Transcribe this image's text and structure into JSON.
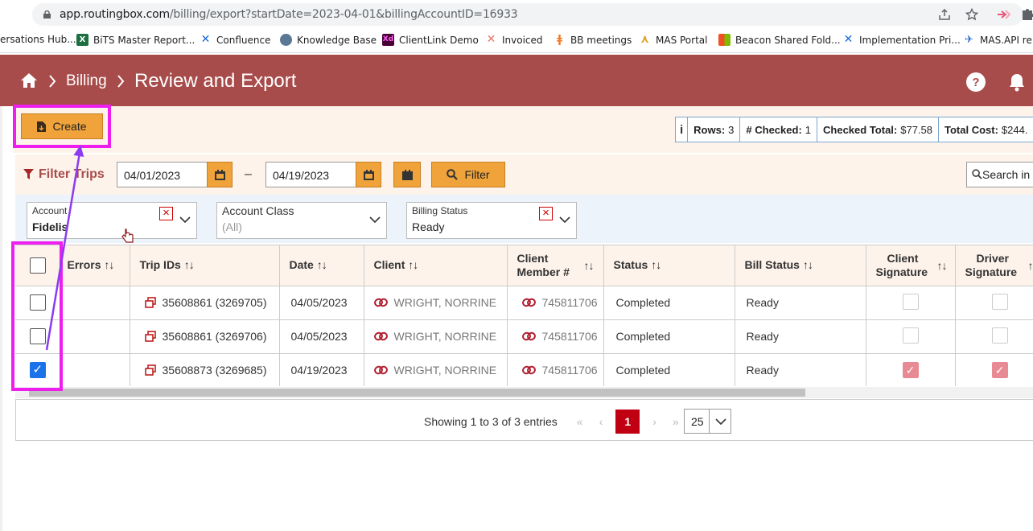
{
  "browser": {
    "url_host": "app.routingbox.com",
    "url_path": "/billing/export?startDate=2023-04-01&billingAccountID=16933",
    "bookmarks": [
      {
        "label": "ersations Hub...",
        "icon": "none"
      },
      {
        "label": "BiTS Master Report...",
        "icon": "excel-icon"
      },
      {
        "label": "Confluence",
        "icon": "confluence-icon"
      },
      {
        "label": "Knowledge Base",
        "icon": "globe-icon"
      },
      {
        "label": "ClientLink Demo",
        "icon": "xd-icon"
      },
      {
        "label": "Invoiced",
        "icon": "invoiced-icon"
      },
      {
        "label": "BB meetings",
        "icon": "hubspot-icon"
      },
      {
        "label": "MAS Portal",
        "icon": "mas-icon"
      },
      {
        "label": "Beacon Shared Fold...",
        "icon": "windows-icon"
      },
      {
        "label": "Implementation Pri...",
        "icon": "confluence-icon"
      },
      {
        "label": "MAS.API re",
        "icon": "api-icon"
      }
    ]
  },
  "header": {
    "crumb1": "Billing",
    "crumb2": "Review and Export",
    "help_icon": "help-icon",
    "bell_icon": "bell-icon"
  },
  "toolbar": {
    "create_label": "Create",
    "summary": {
      "info": "i",
      "rows_label": "Rows:",
      "rows_value": "3",
      "checked_label": "# Checked:",
      "checked_value": "1",
      "checked_total_label": "Checked Total:",
      "checked_total_value": "$77.58",
      "total_cost_label": "Total Cost:",
      "total_cost_value": "$244."
    }
  },
  "filters": {
    "title": "Filter Trips",
    "start_date": "04/01/2023",
    "separator": "–",
    "end_date": "04/19/2023",
    "filter_label": "Filter",
    "search_placeholder": "Search in",
    "account_label": "Account",
    "account_value": "Fidelis",
    "account_class_label": "Account Class",
    "account_class_value": "(All)",
    "billing_status_label": "Billing Status",
    "billing_status_value": "Ready"
  },
  "table": {
    "headers": {
      "errors": "Errors",
      "trip_ids": "Trip IDs",
      "date": "Date",
      "client": "Client",
      "member_line1": "Client",
      "member_line2": "Member #",
      "status": "Status",
      "bill_status": "Bill Status",
      "client_sig_line1": "Client",
      "client_sig_line2": "Signature",
      "driver_sig_line1": "Driver",
      "driver_sig_line2": "Signature",
      "sort_glyph": "↑↓"
    },
    "rows": [
      {
        "checked": false,
        "trip": "35608861 (3269705)",
        "date": "04/05/2023",
        "client": "WRIGHT, NORRINE",
        "member": "745811706",
        "status": "Completed",
        "bill_status": "Ready",
        "client_sig": false,
        "driver_sig": false
      },
      {
        "checked": false,
        "trip": "35608861 (3269706)",
        "date": "04/05/2023",
        "client": "WRIGHT, NORRINE",
        "member": "745811706",
        "status": "Completed",
        "bill_status": "Ready",
        "client_sig": false,
        "driver_sig": false
      },
      {
        "checked": true,
        "trip": "35608873 (3269685)",
        "date": "04/19/2023",
        "client": "WRIGHT, NORRINE",
        "member": "745811706",
        "status": "Completed",
        "bill_status": "Ready",
        "client_sig": true,
        "driver_sig": true
      }
    ]
  },
  "pagination": {
    "showing": "Showing 1 to 3 of 3 entries",
    "first": "«",
    "prev": "‹",
    "current": "1",
    "next": "›",
    "last": "»",
    "page_size": "25"
  },
  "colors": {
    "header_bg": "#a84b4b",
    "button_orange": "#f0a33a",
    "highlight_magenta": "#ee1fee",
    "arrow_purple": "#8b3cf0",
    "active_page": "#c00012"
  }
}
